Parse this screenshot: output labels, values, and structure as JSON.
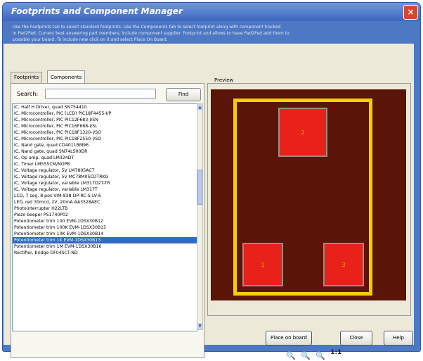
{
  "window": {
    "title": "Footprints and Component Manager",
    "close_label": "×",
    "description_lines": [
      "Use the Footprints tab to select standard footprints. Use the Components tab to select footprint along with component tracked",
      "in Pad2Pad. Current best answering part members, include component supplier. Footprint and allows to have Pad2Pad add them to",
      "possible your board. To include new click on it and select Place On Board."
    ]
  },
  "tabs": [
    {
      "label": "Footprints"
    },
    {
      "label": "Components"
    }
  ],
  "search": {
    "label": "Search:",
    "value": "",
    "find_label": "Find"
  },
  "list": {
    "items": [
      "IC, Half H Driver, quad SN754410",
      "IC, Microcontroller, PIC (LCD) PIC18F4455-I/P",
      "IC, Microcontroller, PIC PIC12F683-I/SN",
      "IC, Microcontroller, PIC PIC16F688-I/SL",
      "IC, Microcontroller, PIC PIC18F1320-I/SO",
      "IC, Microcontroller, PIC PIC18F2550-I/SO",
      "IC, Nand gate, quad CD4011BM96",
      "IC, Nand gate, quad SN74LS00DR",
      "IC, Op amp, quad LM324DT",
      "IC, Timer LM555CM/NOPB",
      "IC, Voltage regulator, 5V LM7805ACT",
      "IC, Voltage regulator, 5V MC78M05CDTRKG",
      "IC, Voltage regulator, variable LM317D2T-TR",
      "IC, Voltage regulator, variable LM317T",
      "LCD, 7 seg, 8 pos VIM-838-DP-RC-S-LV-6",
      "LED, red 30mcd, 2V, 20mA AA3528AEC",
      "Photointerrupter H22LTB",
      "Piezo beeper PS1740P02",
      "Potentiometer trim 100 EVM-1DSX30B12",
      "Potentiometer trim 100K EVM-1DSX30B15",
      "Potentiometer trim 10K EVM-1DSX30B14",
      "Potentiometer trim 1K EVM-1DSX30B13",
      "Potentiometer trim 1M EVM-1DSX30B16",
      "Rectifier, bridge DF04SCT-ND"
    ],
    "selected_index": 21
  },
  "preview": {
    "label": "Preview",
    "pads": [
      "2",
      "1",
      "3"
    ],
    "colors": {
      "board": "#5a1508",
      "outline": "#f2d000",
      "pad": "#e8211b"
    }
  },
  "zoom": {
    "actual_size_label": "1:1"
  },
  "buttons": {
    "place": "Place on board",
    "close": "Close",
    "help": "Help"
  }
}
